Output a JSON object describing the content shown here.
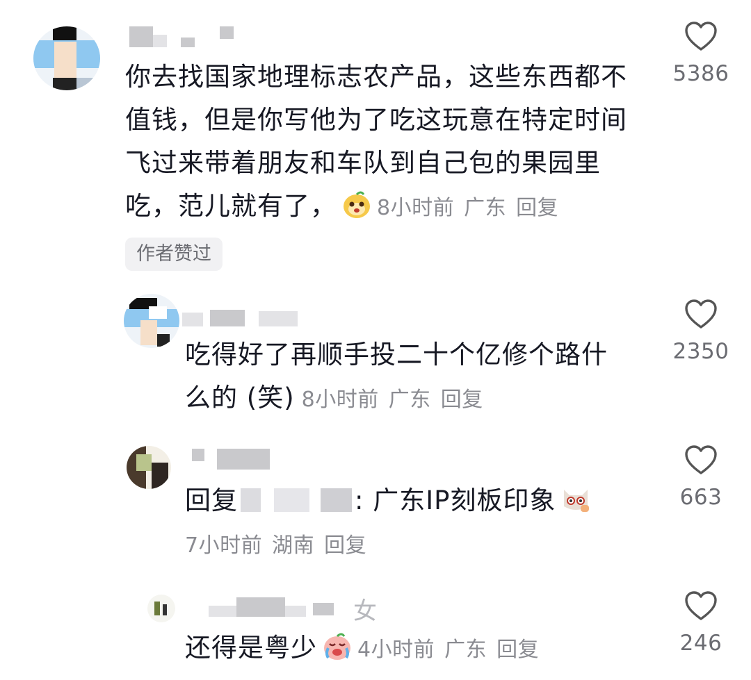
{
  "comments": [
    {
      "text_lines": [
        "你去找国家地理标志农产品，这些东西都不",
        "值钱，但是你写他为了吃这玩意在特定时间",
        "飞过来带着朋友和车队到自己包的果园里",
        "吃，范儿就有了，"
      ],
      "time": "8小时前",
      "location": "广东",
      "reply_label": "回复",
      "likes": "5386",
      "author_tag": "作者赞过"
    },
    {
      "text_lines": [
        "吃得好了再顺手投二十个亿修个路什",
        "么的 (笑)"
      ],
      "time": "8小时前",
      "location": "广东",
      "reply_label": "回复",
      "likes": "2350"
    },
    {
      "reply_prefix": "回复",
      "text_after": ": 广东IP刻板印象",
      "time": "7小时前",
      "location": "湖南",
      "reply_label": "回复",
      "likes": "663"
    },
    {
      "text": "还得是粤少",
      "time": "4小时前",
      "location": "广东",
      "reply_label": "回复",
      "likes": "246",
      "name_suffix": "女"
    }
  ],
  "colors": {
    "text": "#161823",
    "meta": "#8a8b91",
    "like_icon": "#555555"
  },
  "icons": {
    "like": "heart-outline-icon",
    "emoji_1": "smiling-bean-emoji",
    "emoji_2": "shy-cat-emoji",
    "emoji_3": "crying-face-emoji"
  }
}
